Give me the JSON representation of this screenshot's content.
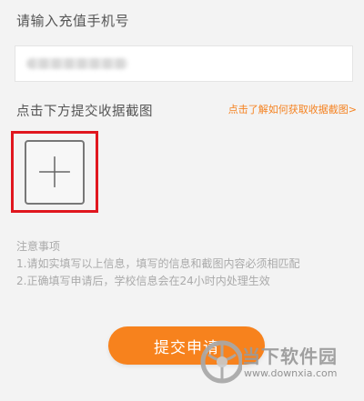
{
  "form": {
    "phone_label": "请输入充值手机号",
    "upload_label": "点击下方提交收据截图",
    "help_link": "点击了解如何获取收据截图>",
    "notes": {
      "title": "注意事项",
      "lines": [
        "1.请如实填写以上信息，填写的信息和截图内容必须相匹配",
        "2.正确填写申请后，学校信息会在24小时内处理生效"
      ]
    },
    "submit_label": "提交申请"
  },
  "watermark": {
    "name": "当下软件园",
    "url": "www.downxia.com"
  },
  "colors": {
    "accent": "#f7821d",
    "highlight": "#e0161e",
    "background": "#f3f3f3"
  }
}
